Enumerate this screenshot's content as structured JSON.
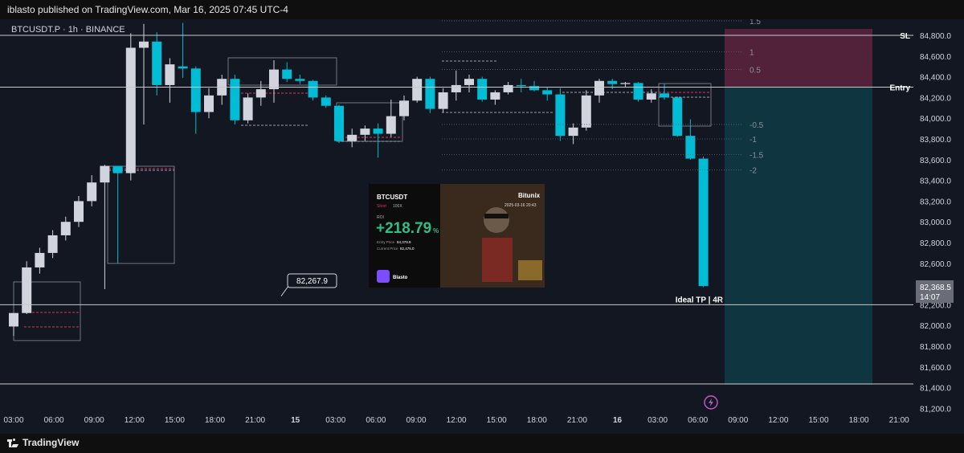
{
  "header": {
    "published": "iblasto published on TradingView.com, Mar 16, 2025 07:45 UTC-4"
  },
  "footer": {
    "brand": "TradingView"
  },
  "chart_meta": {
    "symbol": "BTCUSDT.P · 1h · BINANCE"
  },
  "colors": {
    "background": "#131722",
    "bull_body": "#d1d4dc",
    "bear_body": "#00bcd4",
    "stop_zone": "#5e2440",
    "target_zone": "#0f3a44",
    "line": "#c8c8c8",
    "dashed_red": "#e0335e"
  },
  "levels": [
    {
      "label": "SL",
      "price": 84800
    },
    {
      "label": "Entry",
      "price": 84300
    },
    {
      "label": "Ideal TP | 4R",
      "price": 82200
    }
  ],
  "fib_labels": [
    {
      "text": "1.5",
      "price": 84940
    },
    {
      "text": "1",
      "price": 84640
    },
    {
      "text": "0.5",
      "price": 84470
    },
    {
      "text": "-0.5",
      "price": 83940
    },
    {
      "text": "-1",
      "price": 83800
    },
    {
      "text": "-1.5",
      "price": 83650
    },
    {
      "text": "-2",
      "price": 83500
    }
  ],
  "price_callout": {
    "text": "82,267.9",
    "price": 82267.9
  },
  "last_price": {
    "price": "82,368.5",
    "countdown": "14:07"
  },
  "pnl_card": {
    "pair": "BTCUSDT",
    "side": "Short",
    "leverage": "100X",
    "brand": "Bitunix",
    "time": "2025-03-16 20:43",
    "roi_label": "ROI",
    "roi": "+218.79",
    "roi_unit": "%",
    "entry_label": "Entry Price",
    "entry_value": "84,379.9",
    "current_label": "Current Price",
    "current_value": "82,475.0",
    "user": "Blasto"
  },
  "chart_data": {
    "type": "candlestick",
    "symbol": "BTCUSDT.P",
    "interval": "1h",
    "exchange": "BINANCE",
    "x_tick_labels": [
      "03:00",
      "06:00",
      "09:00",
      "12:00",
      "15:00",
      "18:00",
      "21:00",
      "15",
      "03:00",
      "06:00",
      "09:00",
      "12:00",
      "15:00",
      "18:00",
      "21:00",
      "16",
      "03:00",
      "06:00",
      "09:00",
      "12:00",
      "15:00",
      "18:00",
      "21:00"
    ],
    "y_tick_labels": [
      "84,800.0",
      "84,600.0",
      "84,400.0",
      "84,200.0",
      "84,000.0",
      "83,800.0",
      "83,600.0",
      "83,400.0",
      "83,200.0",
      "83,000.0",
      "82,800.0",
      "82,600.0",
      "82,400.0",
      "82,200.0",
      "82,000.0",
      "81,800.0",
      "81,600.0",
      "81,400.0",
      "81,200.0"
    ],
    "ylim": [
      81150,
      85050
    ],
    "candles": [
      {
        "o": 81990,
        "h": 82100,
        "l": 81900,
        "c": 82120
      },
      {
        "o": 82120,
        "h": 82620,
        "l": 82110,
        "c": 82560
      },
      {
        "o": 82560,
        "h": 82750,
        "l": 82500,
        "c": 82700
      },
      {
        "o": 82700,
        "h": 82920,
        "l": 82650,
        "c": 82870
      },
      {
        "o": 82870,
        "h": 83050,
        "l": 82820,
        "c": 83000
      },
      {
        "o": 83000,
        "h": 83250,
        "l": 82950,
        "c": 83200
      },
      {
        "o": 83200,
        "h": 83450,
        "l": 83150,
        "c": 83380
      },
      {
        "o": 83380,
        "h": 83550,
        "l": 82350,
        "c": 83540
      },
      {
        "o": 83540,
        "h": 83540,
        "l": 82600,
        "c": 83470
      },
      {
        "o": 83470,
        "h": 84820,
        "l": 83400,
        "c": 84680
      },
      {
        "o": 84680,
        "h": 84910,
        "l": 83940,
        "c": 84740
      },
      {
        "o": 84740,
        "h": 84830,
        "l": 84220,
        "c": 84320
      },
      {
        "o": 84320,
        "h": 84580,
        "l": 84150,
        "c": 84520
      },
      {
        "o": 84500,
        "h": 84920,
        "l": 84390,
        "c": 84480
      },
      {
        "o": 84480,
        "h": 84500,
        "l": 83850,
        "c": 84060
      },
      {
        "o": 84060,
        "h": 84290,
        "l": 84000,
        "c": 84220
      },
      {
        "o": 84220,
        "h": 84420,
        "l": 84130,
        "c": 84380
      },
      {
        "o": 84380,
        "h": 84420,
        "l": 83940,
        "c": 83980
      },
      {
        "o": 83980,
        "h": 84240,
        "l": 83950,
        "c": 84200
      },
      {
        "o": 84200,
        "h": 84360,
        "l": 84120,
        "c": 84280
      },
      {
        "o": 84280,
        "h": 84560,
        "l": 84150,
        "c": 84470
      },
      {
        "o": 84470,
        "h": 84540,
        "l": 84350,
        "c": 84380
      },
      {
        "o": 84380,
        "h": 84420,
        "l": 84330,
        "c": 84360
      },
      {
        "o": 84360,
        "h": 84370,
        "l": 84170,
        "c": 84200
      },
      {
        "o": 84200,
        "h": 84220,
        "l": 84100,
        "c": 84120
      },
      {
        "o": 84120,
        "h": 84130,
        "l": 83760,
        "c": 83780
      },
      {
        "o": 83780,
        "h": 83900,
        "l": 83720,
        "c": 83840
      },
      {
        "o": 83840,
        "h": 83930,
        "l": 83780,
        "c": 83900
      },
      {
        "o": 83900,
        "h": 83950,
        "l": 83620,
        "c": 83850
      },
      {
        "o": 83850,
        "h": 84180,
        "l": 83820,
        "c": 84020
      },
      {
        "o": 84020,
        "h": 84220,
        "l": 83980,
        "c": 84170
      },
      {
        "o": 84170,
        "h": 84400,
        "l": 84150,
        "c": 84380
      },
      {
        "o": 84380,
        "h": 84400,
        "l": 84050,
        "c": 84090
      },
      {
        "o": 84090,
        "h": 84290,
        "l": 84060,
        "c": 84250
      },
      {
        "o": 84250,
        "h": 84460,
        "l": 84170,
        "c": 84320
      },
      {
        "o": 84320,
        "h": 84420,
        "l": 84250,
        "c": 84380
      },
      {
        "o": 84380,
        "h": 84400,
        "l": 84160,
        "c": 84180
      },
      {
        "o": 84180,
        "h": 84270,
        "l": 84130,
        "c": 84250
      },
      {
        "o": 84250,
        "h": 84350,
        "l": 84230,
        "c": 84320
      },
      {
        "o": 84320,
        "h": 84380,
        "l": 84250,
        "c": 84310
      },
      {
        "o": 84310,
        "h": 84360,
        "l": 84260,
        "c": 84270
      },
      {
        "o": 84270,
        "h": 84300,
        "l": 84170,
        "c": 84230
      },
      {
        "o": 84230,
        "h": 84290,
        "l": 83780,
        "c": 83830
      },
      {
        "o": 83830,
        "h": 83950,
        "l": 83750,
        "c": 83910
      },
      {
        "o": 83910,
        "h": 84270,
        "l": 83880,
        "c": 84220
      },
      {
        "o": 84220,
        "h": 84380,
        "l": 84150,
        "c": 84360
      },
      {
        "o": 84360,
        "h": 84380,
        "l": 84280,
        "c": 84330
      },
      {
        "o": 84330,
        "h": 84350,
        "l": 84300,
        "c": 84340
      },
      {
        "o": 84340,
        "h": 84350,
        "l": 84160,
        "c": 84180
      },
      {
        "o": 84180,
        "h": 84280,
        "l": 84150,
        "c": 84240
      },
      {
        "o": 84240,
        "h": 84330,
        "l": 84180,
        "c": 84200
      },
      {
        "o": 84200,
        "h": 84210,
        "l": 83820,
        "c": 83830
      },
      {
        "o": 83830,
        "h": 83990,
        "l": 83600,
        "c": 83610
      },
      {
        "o": 83610,
        "h": 83630,
        "l": 82370,
        "c": 82380
      }
    ]
  }
}
